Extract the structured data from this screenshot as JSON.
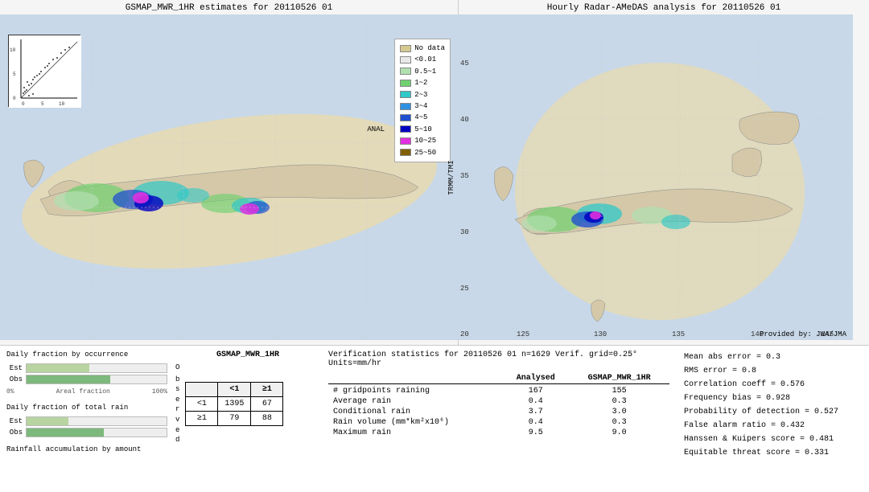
{
  "left_map": {
    "title": "GSMAP_MWR_1HR estimates for 20110526 01",
    "anal_label": "ANAL",
    "trmm_label": "TRMM/TMI"
  },
  "right_map": {
    "title": "Hourly Radar-AMeDAS analysis for 20110526 01",
    "credit": "Provided by: JWA/JMA",
    "lat_labels": [
      "45",
      "40",
      "35",
      "30",
      "25",
      "20"
    ],
    "lon_labels": [
      "125",
      "130",
      "135",
      "140",
      "145"
    ]
  },
  "legend": {
    "items": [
      {
        "label": "No data",
        "color": "#d4c990"
      },
      {
        "label": "<0.01",
        "color": "#e8e8e8"
      },
      {
        "label": "0.5~1",
        "color": "#b0e0b0"
      },
      {
        "label": "1~2",
        "color": "#70d070"
      },
      {
        "label": "2~3",
        "color": "#30c8c8"
      },
      {
        "label": "3~4",
        "color": "#3090e0"
      },
      {
        "label": "4~5",
        "color": "#2050d0"
      },
      {
        "label": "5~10",
        "color": "#0000c0"
      },
      {
        "label": "10~25",
        "color": "#e030e0"
      },
      {
        "label": "25~50",
        "color": "#806000"
      }
    ]
  },
  "daily_charts": {
    "occurrence_title": "Daily fraction by occurrence",
    "total_rain_title": "Daily fraction of total rain",
    "est_label": "Est",
    "obs_label": "Obs",
    "axis_start": "0%",
    "axis_end": "100%",
    "axis_mid": "Areal fraction",
    "rainfall_title": "Rainfall accumulation by amount",
    "est_occurrence": 45,
    "obs_occurrence": 60,
    "est_rain": 30,
    "obs_rain": 55
  },
  "contingency": {
    "title": "GSMAP_MWR_1HR",
    "header_lt1": "<1",
    "header_ge1": "≥1",
    "obs_lt1_est_lt1": "1395",
    "obs_lt1_est_ge1": "67",
    "obs_ge1_est_lt1": "79",
    "obs_ge1_est_ge1": "88",
    "observed_label": "O\nb\ns\ne\nr\nv\ne\nd",
    "lt1_label": "<1",
    "ge1_label": "≥1"
  },
  "verification": {
    "title": "Verification statistics for 20110526 01  n=1629  Verif. grid=0.25°  Units=mm/hr",
    "col_analysed": "Analysed",
    "col_gsmap": "GSMAP_MWR_1HR",
    "rows": [
      {
        "label": "# gridpoints raining",
        "analysed": "167",
        "gsmap": "155"
      },
      {
        "label": "Average rain",
        "analysed": "0.4",
        "gsmap": "0.3"
      },
      {
        "label": "Conditional rain",
        "analysed": "3.7",
        "gsmap": "3.0"
      },
      {
        "label": "Rain volume (mm*km²x10⁶)",
        "analysed": "0.4",
        "gsmap": "0.3"
      },
      {
        "label": "Maximum rain",
        "analysed": "9.5",
        "gsmap": "9.0"
      }
    ]
  },
  "stats": {
    "mean_abs_error": "Mean abs error = 0.3",
    "rms_error": "RMS error = 0.8",
    "correlation": "Correlation coeff = 0.576",
    "freq_bias": "Frequency bias = 0.928",
    "prob_detection": "Probability of detection = 0.527",
    "false_alarm": "False alarm ratio = 0.432",
    "hanssen": "Hanssen & Kuipers score = 0.481",
    "equitable": "Equitable threat score = 0.331"
  }
}
